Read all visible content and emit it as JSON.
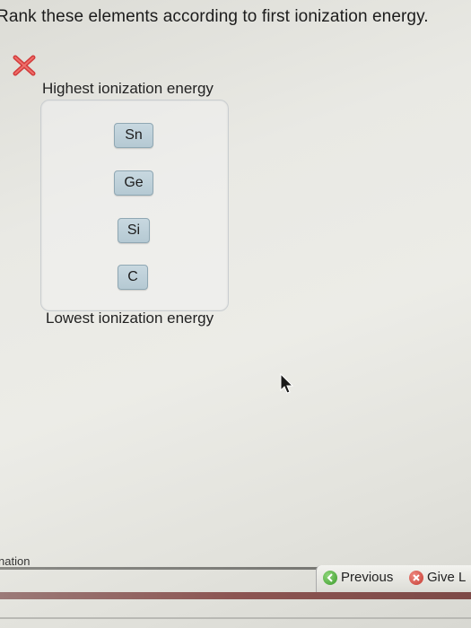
{
  "question": {
    "text": "Rank these elements according to first ionization energy."
  },
  "status": {
    "icon": "x-mark-icon",
    "color": "#d03a3a"
  },
  "ranking": {
    "top_label": "Highest ionization energy",
    "bottom_label": "Lowest ionization energy",
    "items": [
      {
        "label": "Sn"
      },
      {
        "label": "Ge"
      },
      {
        "label": "Si"
      },
      {
        "label": "C"
      }
    ]
  },
  "footer": {
    "left_text": "nation",
    "previous_label": "Previous",
    "give_up_label": "Give L"
  },
  "colors": {
    "chip_bg": "#bfd1da",
    "chip_border": "#8fa7b3",
    "nav_green": "#3a9a2a",
    "nav_red": "#c43a30"
  }
}
